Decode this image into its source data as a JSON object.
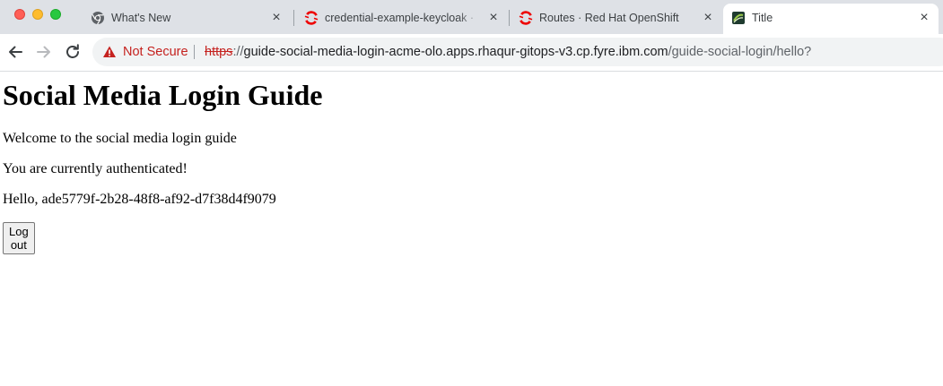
{
  "window": {
    "controls": [
      "close",
      "minimize",
      "zoom"
    ]
  },
  "tabs": [
    {
      "title": "What's New",
      "icon": "chrome-icon",
      "active": false
    },
    {
      "title": "credential-example-keycloak · ",
      "icon": "openshift-icon",
      "active": false
    },
    {
      "title": "Routes · Red Hat OpenShift",
      "icon": "openshift-icon",
      "active": false
    },
    {
      "title": "Title",
      "icon": "app-logo-icon",
      "active": true
    }
  ],
  "toolbar": {
    "security_label": "Not Secure",
    "url_scheme": "https",
    "url_separator": "://",
    "url_host": "guide-social-media-login-acme-olo.apps.rhaqur-gitops-v3.cp.fyre.ibm.com",
    "url_path": "/guide-social-login/hello?"
  },
  "page": {
    "heading": "Social Media Login Guide",
    "welcome": "Welcome to the social media login guide",
    "status": "You are currently authenticated!",
    "greeting": "Hello, ade5779f-2b28-48f8-af92-d7f38d4f9079",
    "logout_label": "Log out"
  },
  "colors": {
    "tabstrip": "#dee1e6",
    "insecure_red": "#c5221f",
    "openshift_red": "#ee0000"
  }
}
